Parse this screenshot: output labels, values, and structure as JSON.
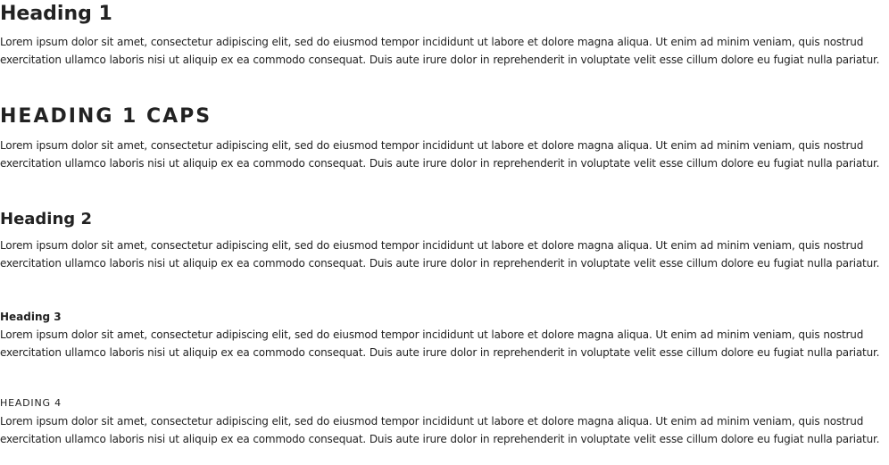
{
  "sections": [
    {
      "heading": "Heading 1",
      "body": "Lorem ipsum dolor sit amet, consectetur adipiscing elit, sed do eiusmod tempor incididunt ut labore et dolore magna aliqua. Ut enim ad minim veniam, quis nostrud exercitation ullamco laboris nisi ut aliquip ex ea commodo consequat. Duis aute irure dolor in reprehenderit in voluptate velit esse cillum dolore eu fugiat nulla pariatur."
    },
    {
      "heading": "HEADING 1 CAPS",
      "body": "Lorem ipsum dolor sit amet, consectetur adipiscing elit, sed do eiusmod tempor incididunt ut labore et dolore magna aliqua. Ut enim ad minim veniam, quis nostrud exercitation ullamco laboris nisi ut aliquip ex ea commodo consequat. Duis aute irure dolor in reprehenderit in voluptate velit esse cillum dolore eu fugiat nulla pariatur."
    },
    {
      "heading": "Heading 2",
      "body": "Lorem ipsum dolor sit amet, consectetur adipiscing elit, sed do eiusmod tempor incididunt ut labore et dolore magna aliqua. Ut enim ad minim veniam, quis nostrud exercitation ullamco laboris nisi ut aliquip ex ea commodo consequat. Duis aute irure dolor in reprehenderit in voluptate velit esse cillum dolore eu fugiat nulla pariatur."
    },
    {
      "heading": "Heading 3",
      "body": "Lorem ipsum dolor sit amet, consectetur adipiscing elit, sed do eiusmod tempor incididunt ut labore et dolore magna aliqua. Ut enim ad minim veniam, quis nostrud exercitation ullamco laboris nisi ut aliquip ex ea commodo consequat. Duis aute irure dolor in reprehenderit in voluptate velit esse cillum dolore eu fugiat nulla pariatur."
    },
    {
      "heading": "HEADING 4",
      "body": "Lorem ipsum dolor sit amet, consectetur adipiscing elit, sed do eiusmod tempor incididunt ut labore et dolore magna aliqua. Ut enim ad minim veniam, quis nostrud exercitation ullamco laboris nisi ut aliquip ex ea commodo consequat. Duis aute irure dolor in reprehenderit in voluptate velit esse cillum dolore eu fugiat nulla pariatur."
    }
  ],
  "colors": {
    "text": "#222222",
    "background": "#ffffff"
  }
}
